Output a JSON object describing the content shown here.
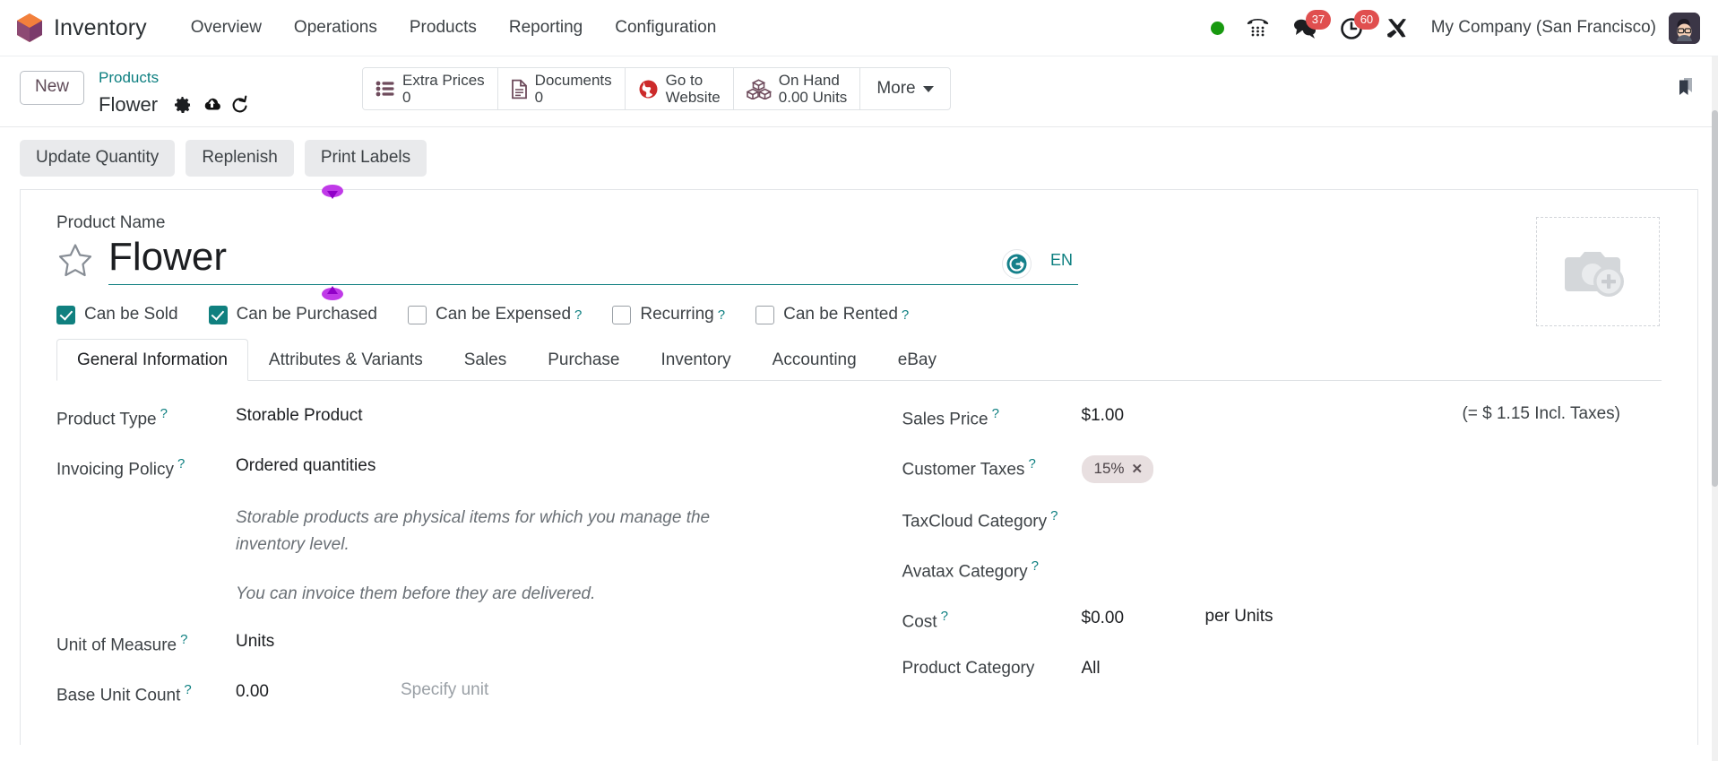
{
  "navbar": {
    "brand": "Inventory",
    "menu": [
      {
        "label": "Overview"
      },
      {
        "label": "Operations"
      },
      {
        "label": "Products"
      },
      {
        "label": "Reporting"
      },
      {
        "label": "Configuration"
      }
    ],
    "systray": {
      "presence_status": "online",
      "dialpad_icon": "phone-dialpad-icon",
      "messages_icon": "chat-bubbles-icon",
      "messages_count": "37",
      "activities_icon": "clock-icon",
      "activities_count": "60",
      "tools_icon": "tools-icon"
    },
    "company": "My Company (San Francisco)",
    "avatar": "user-avatar"
  },
  "control_panel": {
    "new_button": "New",
    "breadcrumb_parent": "Products",
    "breadcrumb_current": "Flower",
    "gear_icon": "gear-icon",
    "save_icon": "cloud-upload-icon",
    "discard_icon": "undo-icon",
    "bookmark_icon": "bookmark-icon",
    "stat_buttons": [
      {
        "icon": "list-icon",
        "label": "Extra Prices",
        "value": "0"
      },
      {
        "icon": "document-icon",
        "label": "Documents",
        "value": "0"
      },
      {
        "icon": "globe-icon",
        "label": "Go to",
        "value": "Website"
      },
      {
        "icon": "boxes-icon",
        "label": "On Hand",
        "value": "0.00 Units"
      }
    ],
    "more_button": "More"
  },
  "action_buttons": [
    {
      "label": "Update Quantity"
    },
    {
      "label": "Replenish"
    },
    {
      "label": "Print Labels"
    }
  ],
  "form": {
    "image_placeholder_icon": "camera-plus-icon",
    "favorite_icon": "star-outline-icon",
    "product_name_label": "Product Name",
    "product_name_value": "Flower",
    "grammarly_icon": "grammarly-icon",
    "language_badge": "EN",
    "selection_handle_color": "#b425e0",
    "checkboxes": [
      {
        "label": "Can be Sold",
        "checked": true,
        "help": false
      },
      {
        "label": "Can be Purchased",
        "checked": true,
        "help": false
      },
      {
        "label": "Can be Expensed",
        "checked": false,
        "help": true
      },
      {
        "label": "Recurring",
        "checked": false,
        "help": true
      },
      {
        "label": "Can be Rented",
        "checked": false,
        "help": true
      }
    ],
    "tabs": [
      {
        "label": "General Information",
        "active": true
      },
      {
        "label": "Attributes & Variants",
        "active": false
      },
      {
        "label": "Sales",
        "active": false
      },
      {
        "label": "Purchase",
        "active": false
      },
      {
        "label": "Inventory",
        "active": false
      },
      {
        "label": "Accounting",
        "active": false
      },
      {
        "label": "eBay",
        "active": false
      }
    ],
    "left_fields": {
      "product_type_label": "Product Type",
      "product_type_value": "Storable Product",
      "invoicing_policy_label": "Invoicing Policy",
      "invoicing_policy_value": "Ordered quantities",
      "hint_1": "Storable products are physical items for which you manage the inventory level.",
      "hint_2": "You can invoice them before they are delivered.",
      "uom_label": "Unit of Measure",
      "uom_value": "Units",
      "base_unit_count_label": "Base Unit Count",
      "base_unit_count_value": "0.00",
      "base_unit_placeholder": "Specify unit"
    },
    "right_fields": {
      "sales_price_label": "Sales Price",
      "sales_price_value": "$1.00",
      "sales_price_note": "(= $ 1.15 Incl. Taxes)",
      "customer_taxes_label": "Customer Taxes",
      "customer_taxes_tag": "15%",
      "taxcloud_label": "TaxCloud Category",
      "taxcloud_value": "",
      "avatax_label": "Avatax Category",
      "avatax_value": "",
      "cost_label": "Cost",
      "cost_value": "$0.00",
      "cost_suffix": "per Units",
      "product_category_label": "Product Category",
      "product_category_value": "All"
    }
  },
  "theme": {
    "accent": "#0d7f80",
    "badge_red": "#e04f4f",
    "online_green": "#18990f",
    "stat_icon": "#6e4b5c"
  }
}
